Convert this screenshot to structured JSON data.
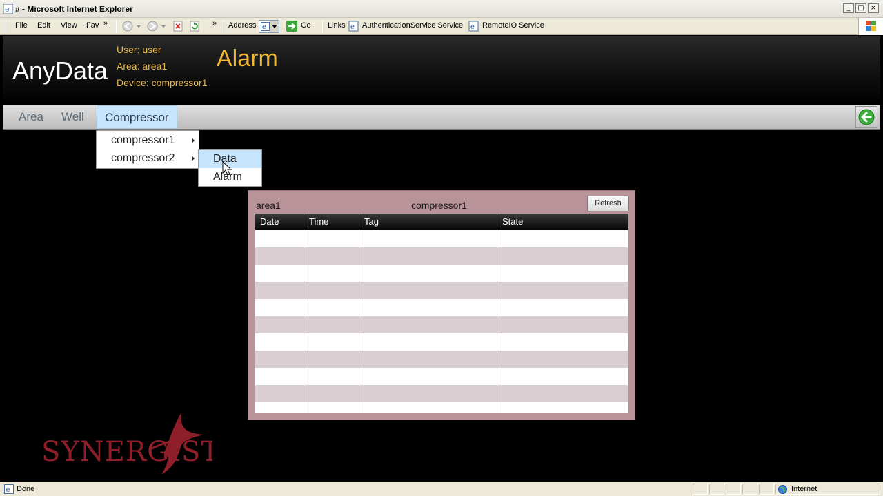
{
  "window": {
    "title": "# - Microsoft Internet Explorer",
    "controls": [
      "_",
      "□",
      "×"
    ]
  },
  "toolbar": {
    "menu": [
      "File",
      "Edit",
      "View",
      "Fav"
    ],
    "overflow": "»",
    "address_label": "Address",
    "go_label": "Go",
    "links_label": "Links",
    "links": [
      "AuthenticationService Service",
      "RemoteIO Service"
    ]
  },
  "app": {
    "brand": "AnyData",
    "user": "User: user",
    "area": "Area: area1",
    "device": "Device: compressor1",
    "page_title": "Alarm",
    "nav": [
      "Area",
      "Well",
      "Compressor"
    ],
    "active_nav": "Compressor",
    "submenu": [
      "compressor1",
      "compressor2"
    ],
    "flyout": [
      "Data",
      "Alarm"
    ],
    "highlighted": "Data"
  },
  "panel": {
    "area": "area1",
    "device": "compressor1",
    "refresh_label": "Refresh",
    "columns": [
      "Date",
      "Time",
      "Tag",
      "State"
    ]
  },
  "logo": {
    "text": "SYNERGIST"
  },
  "statusbar": {
    "status": "Done",
    "zone": "Internet"
  },
  "colors": {
    "accent_gold": "#f0b733",
    "info_text": "#e8b84a",
    "nav_active": "#c6e4fb",
    "panel_bg": "#b8949a",
    "logo_red": "#8e1f2a"
  }
}
